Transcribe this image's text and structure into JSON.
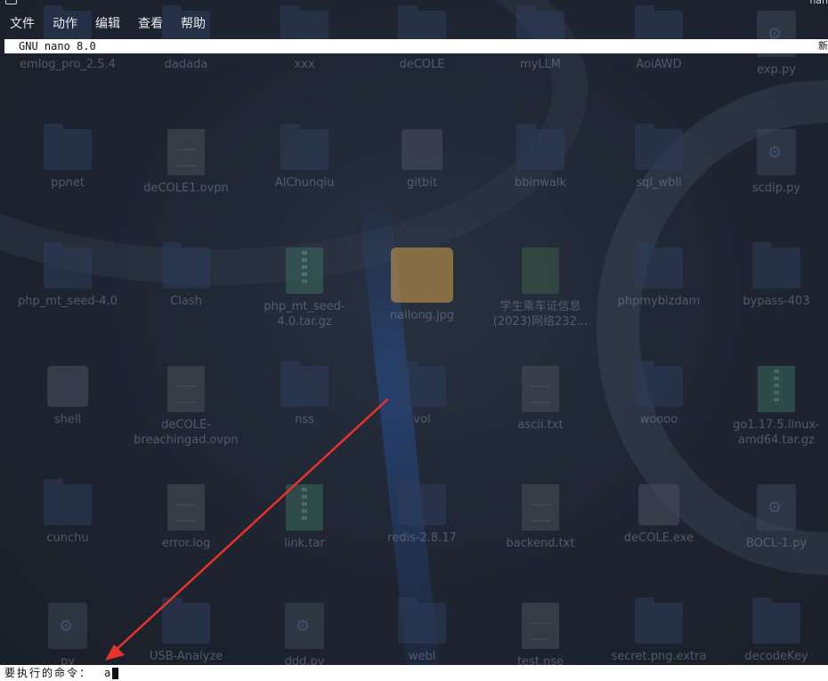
{
  "window": {
    "title_fragment": "nan"
  },
  "menubar": {
    "items": [
      "文件",
      "动作",
      "编辑",
      "查看",
      "帮助"
    ]
  },
  "nano": {
    "title": "GNU nano 8.0",
    "right_fragment": "新"
  },
  "prompt": {
    "label": "要执行的命令：",
    "value": "a"
  },
  "annotation": {
    "arrow_color": "#e8322a"
  },
  "desktop": {
    "icons": [
      {
        "name": "emlog_pro_2.5.4",
        "type": "folder"
      },
      {
        "name": "dadada",
        "type": "folder"
      },
      {
        "name": "xxx",
        "type": "folder"
      },
      {
        "name": "deCOLE",
        "type": "folder"
      },
      {
        "name": "myLLM",
        "type": "folder"
      },
      {
        "name": "AoiAWD",
        "type": "folder"
      },
      {
        "name": "exp.py",
        "type": "python"
      },
      {
        "name": "ppnet",
        "type": "folder"
      },
      {
        "name": "deCOLE1.ovpn",
        "type": "file"
      },
      {
        "name": "AIChunqiu",
        "type": "folder"
      },
      {
        "name": "gitbit",
        "type": "app"
      },
      {
        "name": "bbinwalk",
        "type": "folder"
      },
      {
        "name": "sql_wbll",
        "type": "folder"
      },
      {
        "name": "scdip.py",
        "type": "python"
      },
      {
        "name": "php_mt_seed-4.0",
        "type": "folder"
      },
      {
        "name": "Clash",
        "type": "folder"
      },
      {
        "name": "php_mt_seed-4.0.tar.gz",
        "type": "zip"
      },
      {
        "name": "nailong.jpg",
        "type": "image"
      },
      {
        "name": "学生乘车证信息(2023)网络232...",
        "type": "sheet"
      },
      {
        "name": "phpmybizdam",
        "type": "folder"
      },
      {
        "name": "bypass-403",
        "type": "folder"
      },
      {
        "name": "shell",
        "type": "app"
      },
      {
        "name": "deCOLE-breachingad.ovpn",
        "type": "file"
      },
      {
        "name": "nss",
        "type": "folder"
      },
      {
        "name": "vol",
        "type": "folder"
      },
      {
        "name": "ascii.txt",
        "type": "file"
      },
      {
        "name": "woooo",
        "type": "folder"
      },
      {
        "name": "go1.17.5.linux-amd64.tar.gz",
        "type": "zip"
      },
      {
        "name": "cunchu",
        "type": "folder"
      },
      {
        "name": "error.log",
        "type": "file"
      },
      {
        "name": "link.tar",
        "type": "zip"
      },
      {
        "name": "redis-2.8.17",
        "type": "folder"
      },
      {
        "name": "backend.txt",
        "type": "file"
      },
      {
        "name": "deCOLE.exe",
        "type": "exe"
      },
      {
        "name": "BOCL-1.py",
        "type": "python"
      },
      {
        "name": "py",
        "type": "python"
      },
      {
        "name": "USB-Analyze",
        "type": "folder"
      },
      {
        "name": "ddd.py",
        "type": "python"
      },
      {
        "name": "webl",
        "type": "folder"
      },
      {
        "name": "test.nse",
        "type": "file"
      },
      {
        "name": "secret.png.extra",
        "type": "folder"
      },
      {
        "name": "decodeKey",
        "type": "folder"
      }
    ]
  }
}
